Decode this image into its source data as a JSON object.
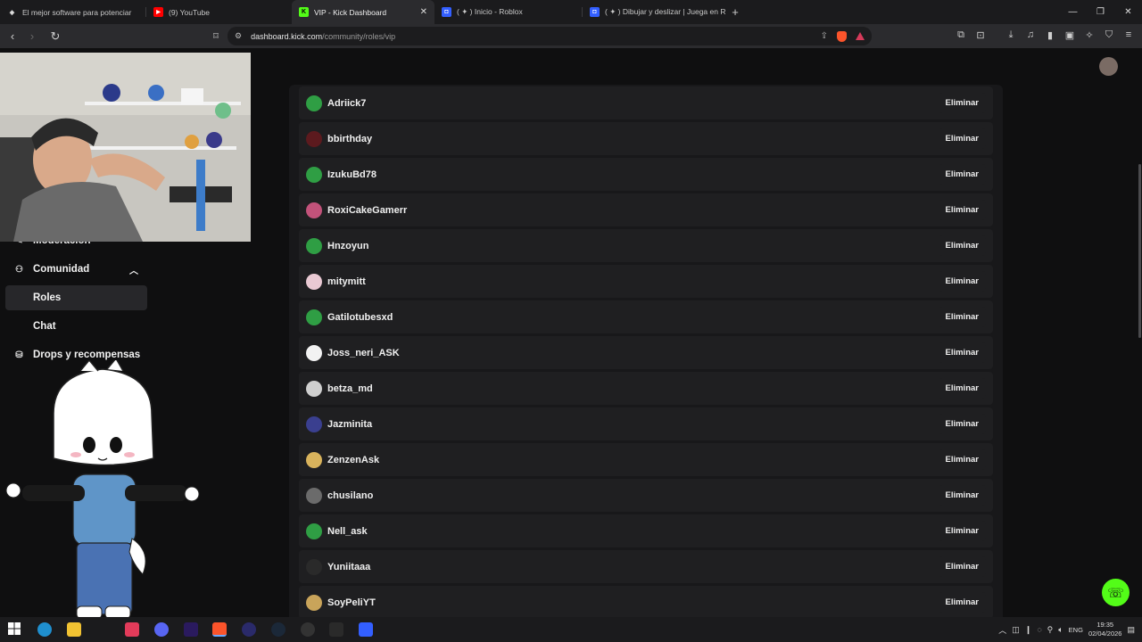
{
  "browser": {
    "tabs": [
      {
        "title": "El mejor software para potenciar",
        "color": "#e8e8e8",
        "glyph": "◈"
      },
      {
        "title": "(9) YouTube",
        "color": "#ff0000",
        "glyph": "▶"
      },
      {
        "title": "VIP - Kick Dashboard",
        "color": "#53fc18",
        "glyph": "K",
        "active": true
      },
      {
        "title": "( ✦ ) Inicio - Roblox",
        "color": "#335fff",
        "glyph": "◘"
      },
      {
        "title": "( ✦ ) Dibujar y deslizar | Juega en Ro",
        "color": "#335fff",
        "glyph": "◘"
      }
    ],
    "url_host": "dashboard.kick.com",
    "url_path": "/community/roles/vip"
  },
  "sidebar": {
    "items": [
      {
        "label": "Moderación",
        "icon": "shield-icon"
      },
      {
        "label": "Comunidad",
        "icon": "people-icon"
      },
      {
        "label": "Roles",
        "icon": ""
      },
      {
        "label": "Chat",
        "icon": ""
      },
      {
        "label": "Drops y recompensas",
        "icon": "gift-icon"
      }
    ]
  },
  "vip_list": {
    "remove_label": "Eliminar",
    "users": [
      {
        "name": "Adriick7",
        "avatar_color": "#2f9e44"
      },
      {
        "name": "bbirthday",
        "avatar_color": "#5c1a1e"
      },
      {
        "name": "IzukuBd78",
        "avatar_color": "#2f9e44"
      },
      {
        "name": "RoxiCakeGamerr",
        "avatar_color": "#c2527a"
      },
      {
        "name": "Hnzoyun",
        "avatar_color": "#2f9e44"
      },
      {
        "name": "mitymitt",
        "avatar_color": "#e9c9d3"
      },
      {
        "name": "Gatilotubesxd",
        "avatar_color": "#2f9e44"
      },
      {
        "name": "Joss_neri_ASK",
        "avatar_color": "#f2f2f2"
      },
      {
        "name": "betza_md",
        "avatar_color": "#cfcfcf"
      },
      {
        "name": "Jazminita",
        "avatar_color": "#3a3f8f"
      },
      {
        "name": "ZenzenAsk",
        "avatar_color": "#d9b35c"
      },
      {
        "name": "chusilano",
        "avatar_color": "#6b6b6b"
      },
      {
        "name": "Nell_ask",
        "avatar_color": "#2f9e44"
      },
      {
        "name": "Yuniitaaa",
        "avatar_color": "#2a2a2a"
      },
      {
        "name": "SoyPeliYT",
        "avatar_color": "#c9a45a"
      }
    ]
  },
  "taskbar": {
    "lang": "ENG",
    "time": "19:35",
    "date": "02/04/2026"
  },
  "colors": {
    "accent": "#53fc18",
    "panel": "#18181a",
    "row": "#1f1f21"
  }
}
